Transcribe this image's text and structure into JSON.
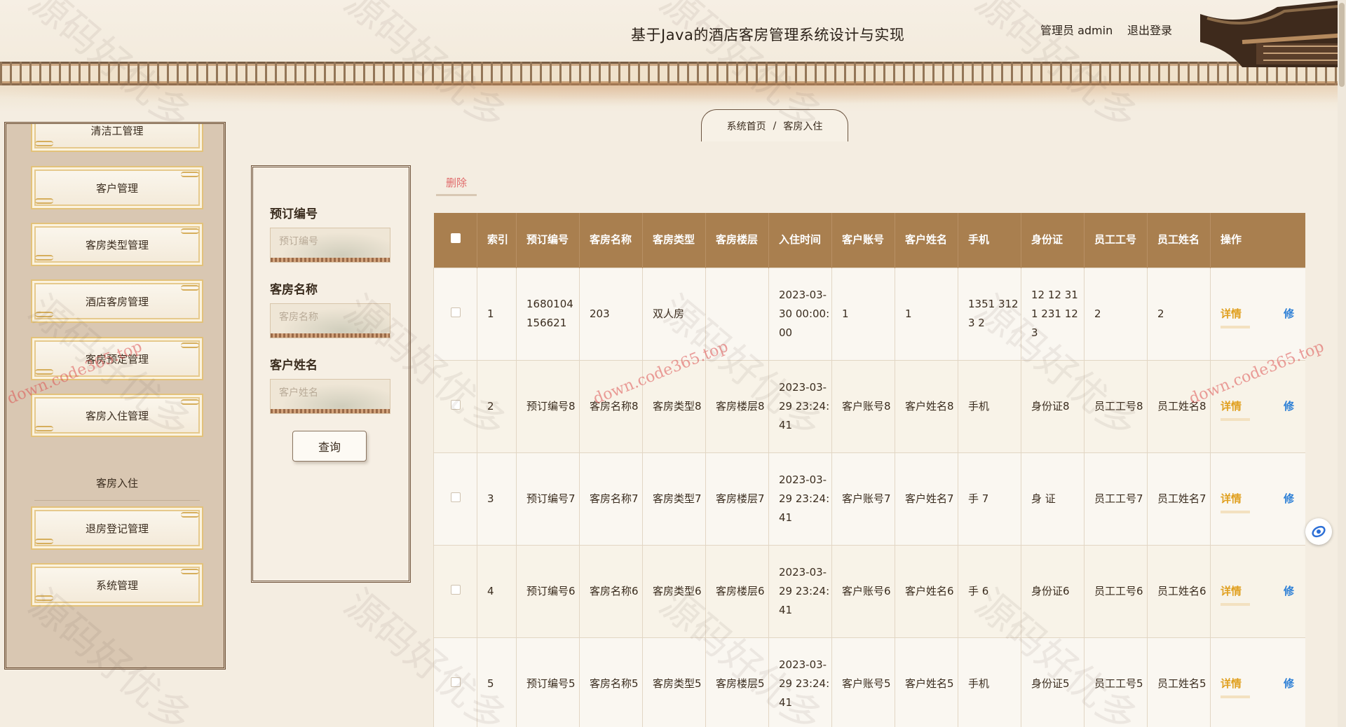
{
  "header": {
    "title": "基于Java的酒店客房管理系统设计与实现",
    "admin": "管理员 admin",
    "logout": "退出登录"
  },
  "breadcrumb": {
    "home": "系统首页",
    "separator": "/",
    "current": "客房入住"
  },
  "sidebar": {
    "items": [
      {
        "label": "清洁工管理"
      },
      {
        "label": "客户管理"
      },
      {
        "label": "客房类型管理"
      },
      {
        "label": "酒店客房管理"
      },
      {
        "label": "客房预定管理"
      },
      {
        "label": "客房入住管理"
      },
      {
        "label": "退房登记管理"
      },
      {
        "label": "系统管理"
      }
    ],
    "active_sub": "客房入住"
  },
  "search": {
    "booking_no_label": "预订编号",
    "booking_no_placeholder": "预订编号",
    "room_name_label": "客房名称",
    "room_name_placeholder": "客房名称",
    "customer_name_label": "客户姓名",
    "customer_name_placeholder": "客户姓名",
    "query_label": "查询"
  },
  "toolbar": {
    "delete_label": "删除"
  },
  "table": {
    "headers": [
      "索引",
      "预订编号",
      "客房名称",
      "客房类型",
      "客房楼层",
      "入住时间",
      "客户账号",
      "客户姓名",
      "手机",
      "身份证",
      "员工工号",
      "员工姓名",
      "操作"
    ],
    "rows": [
      {
        "index": "1",
        "booking_no": "1680104156621",
        "room_name": "203",
        "room_type": "双人房",
        "floor": "",
        "checkin": "2023-03-30 00:00:00",
        "account": "1",
        "customer": "1",
        "phone": "1351 3123 2",
        "id_card": "12 12 31 1 231 123",
        "emp_no": "2",
        "emp_name": "2"
      },
      {
        "index": "2",
        "booking_no": "预订编号8",
        "room_name": "客房名称8",
        "room_type": "客房类型8",
        "floor": "客房楼层8",
        "checkin": "2023-03-29 23:24:41",
        "account": "客户账号8",
        "customer": "客户姓名8",
        "phone": "手机",
        "id_card": "身份证8",
        "emp_no": "员工工号8",
        "emp_name": "员工姓名8"
      },
      {
        "index": "3",
        "booking_no": "预订编号7",
        "room_name": "客房名称7",
        "room_type": "客房类型7",
        "floor": "客房楼层7",
        "checkin": "2023-03-29 23:24:41",
        "account": "客户账号7",
        "customer": "客户姓名7",
        "phone": "手 7",
        "id_card": "身 证",
        "emp_no": "员工工号7",
        "emp_name": "员工姓名7"
      },
      {
        "index": "4",
        "booking_no": "预订编号6",
        "room_name": "客房名称6",
        "room_type": "客房类型6",
        "floor": "客房楼层6",
        "checkin": "2023-03-29 23:24:41",
        "account": "客户账号6",
        "customer": "客户姓名6",
        "phone": "手 6",
        "id_card": "身份证6",
        "emp_no": "员工工号6",
        "emp_name": "员工姓名6"
      },
      {
        "index": "5",
        "booking_no": "预订编号5",
        "room_name": "客房名称5",
        "room_type": "客房类型5",
        "floor": "客房楼层5",
        "checkin": "2023-03-29 23:24:41",
        "account": "客户账号5",
        "customer": "客户姓名5",
        "phone": "手机",
        "id_card": "身份证5",
        "emp_no": "员工工号5",
        "emp_name": "员工姓名5"
      }
    ],
    "detail_label": "详情",
    "edit_label": "修"
  },
  "watermark": {
    "text": "源码好优多",
    "url": "down.code365.top"
  },
  "colors": {
    "header_row": "#a97f4f",
    "delete": "#e06a6a",
    "detail": "#e0a020",
    "edit": "#2c7fd6"
  }
}
